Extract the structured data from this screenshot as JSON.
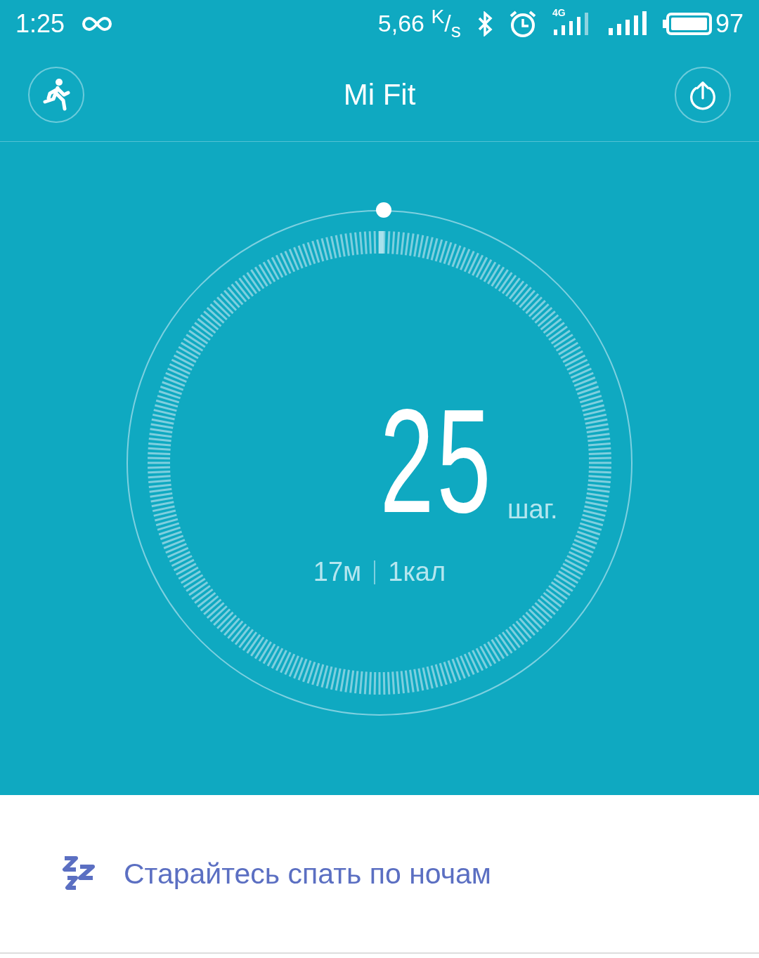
{
  "status_bar": {
    "time": "1:25",
    "speed": "5,66 $^{K}$/$_{s}$",
    "network": "4G",
    "battery": "97"
  },
  "header": {
    "title": "Mi Fit"
  },
  "steps": {
    "count": "25",
    "unit": "шаг.",
    "distance": "17м",
    "calories": "1кал"
  },
  "tip": {
    "text": "Старайтесь спать по ночам"
  }
}
